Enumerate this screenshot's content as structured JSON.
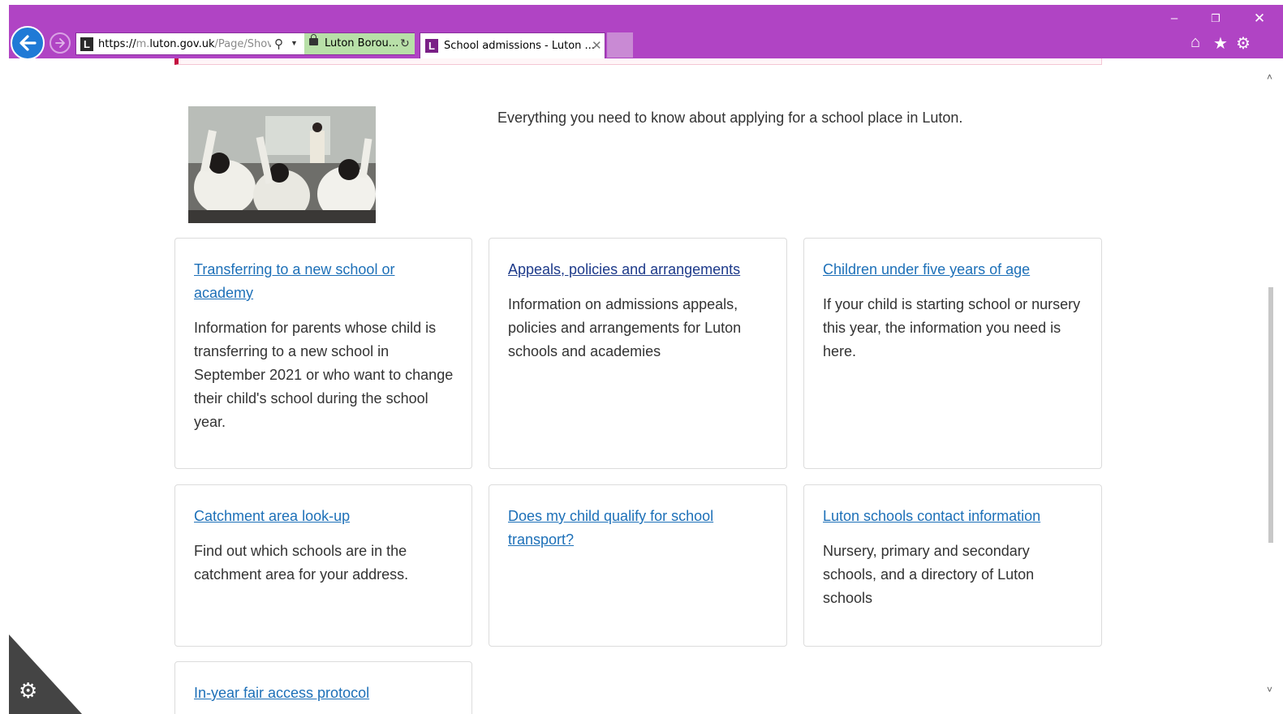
{
  "window": {
    "minimize_glyph": "–",
    "restore_glyph": "❐",
    "close_glyph": "✕"
  },
  "browser": {
    "address_bar": {
      "favicon_letter": "L",
      "url_scheme": "https://",
      "url_prefix": "m.",
      "url_domain": "luton.gov.uk",
      "url_path": "/Page/Shov",
      "site_identity": "Luton Borou..."
    },
    "tab": {
      "favicon_letter": "L",
      "title": "School admissions - Luton ...",
      "close_glyph": "✕"
    },
    "icons": [
      "back-icon",
      "forward-icon",
      "search-icon",
      "lock-icon",
      "refresh-icon",
      "home-icon",
      "star-icon",
      "gear-icon",
      "smiley-icon"
    ]
  },
  "page": {
    "intro": "Everything you need to know about applying for a school place in Luton.",
    "hero_image": "classroom-photo",
    "cards": [
      {
        "link": "Transferring to a new school or academy",
        "description": "Information for parents whose child is transferring to a new school in September 2021 or who want to change their child's school during the school year."
      },
      {
        "link": "Appeals, policies and arrangements",
        "description": "Information on admissions appeals, policies and arrangements for Luton schools and academies"
      },
      {
        "link": "Children under five years of age",
        "description": "If your child is starting school or nursery this year, the information you need is here."
      },
      {
        "link": "Catchment area look-up",
        "description": "Find out which schools are in the catchment area for your address."
      },
      {
        "link": "Does my child qualify for school transport?",
        "description": ""
      },
      {
        "link": "Luton schools contact information",
        "description": "Nursery, primary and secondary schools, and a directory of Luton schools"
      },
      {
        "link": "In-year fair access protocol",
        "description": ""
      }
    ]
  },
  "colors": {
    "chrome": "#b044c4",
    "link": "#1d70b8",
    "visited_link": "#1d3a8a",
    "alert_border": "#c4103f",
    "body_text": "#333333"
  }
}
